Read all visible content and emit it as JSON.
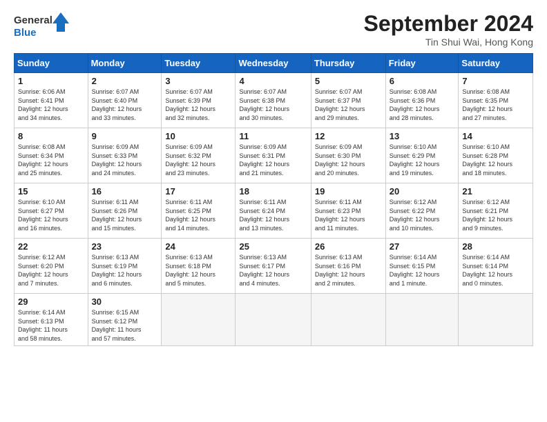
{
  "header": {
    "logo_line1": "General",
    "logo_line2": "Blue",
    "month_title": "September 2024",
    "location": "Tin Shui Wai, Hong Kong"
  },
  "weekdays": [
    "Sunday",
    "Monday",
    "Tuesday",
    "Wednesday",
    "Thursday",
    "Friday",
    "Saturday"
  ],
  "weeks": [
    [
      {
        "day": "1",
        "info": "Sunrise: 6:06 AM\nSunset: 6:41 PM\nDaylight: 12 hours\nand 34 minutes."
      },
      {
        "day": "2",
        "info": "Sunrise: 6:07 AM\nSunset: 6:40 PM\nDaylight: 12 hours\nand 33 minutes."
      },
      {
        "day": "3",
        "info": "Sunrise: 6:07 AM\nSunset: 6:39 PM\nDaylight: 12 hours\nand 32 minutes."
      },
      {
        "day": "4",
        "info": "Sunrise: 6:07 AM\nSunset: 6:38 PM\nDaylight: 12 hours\nand 30 minutes."
      },
      {
        "day": "5",
        "info": "Sunrise: 6:07 AM\nSunset: 6:37 PM\nDaylight: 12 hours\nand 29 minutes."
      },
      {
        "day": "6",
        "info": "Sunrise: 6:08 AM\nSunset: 6:36 PM\nDaylight: 12 hours\nand 28 minutes."
      },
      {
        "day": "7",
        "info": "Sunrise: 6:08 AM\nSunset: 6:35 PM\nDaylight: 12 hours\nand 27 minutes."
      }
    ],
    [
      {
        "day": "8",
        "info": "Sunrise: 6:08 AM\nSunset: 6:34 PM\nDaylight: 12 hours\nand 25 minutes."
      },
      {
        "day": "9",
        "info": "Sunrise: 6:09 AM\nSunset: 6:33 PM\nDaylight: 12 hours\nand 24 minutes."
      },
      {
        "day": "10",
        "info": "Sunrise: 6:09 AM\nSunset: 6:32 PM\nDaylight: 12 hours\nand 23 minutes."
      },
      {
        "day": "11",
        "info": "Sunrise: 6:09 AM\nSunset: 6:31 PM\nDaylight: 12 hours\nand 21 minutes."
      },
      {
        "day": "12",
        "info": "Sunrise: 6:09 AM\nSunset: 6:30 PM\nDaylight: 12 hours\nand 20 minutes."
      },
      {
        "day": "13",
        "info": "Sunrise: 6:10 AM\nSunset: 6:29 PM\nDaylight: 12 hours\nand 19 minutes."
      },
      {
        "day": "14",
        "info": "Sunrise: 6:10 AM\nSunset: 6:28 PM\nDaylight: 12 hours\nand 18 minutes."
      }
    ],
    [
      {
        "day": "15",
        "info": "Sunrise: 6:10 AM\nSunset: 6:27 PM\nDaylight: 12 hours\nand 16 minutes."
      },
      {
        "day": "16",
        "info": "Sunrise: 6:11 AM\nSunset: 6:26 PM\nDaylight: 12 hours\nand 15 minutes."
      },
      {
        "day": "17",
        "info": "Sunrise: 6:11 AM\nSunset: 6:25 PM\nDaylight: 12 hours\nand 14 minutes."
      },
      {
        "day": "18",
        "info": "Sunrise: 6:11 AM\nSunset: 6:24 PM\nDaylight: 12 hours\nand 13 minutes."
      },
      {
        "day": "19",
        "info": "Sunrise: 6:11 AM\nSunset: 6:23 PM\nDaylight: 12 hours\nand 11 minutes."
      },
      {
        "day": "20",
        "info": "Sunrise: 6:12 AM\nSunset: 6:22 PM\nDaylight: 12 hours\nand 10 minutes."
      },
      {
        "day": "21",
        "info": "Sunrise: 6:12 AM\nSunset: 6:21 PM\nDaylight: 12 hours\nand 9 minutes."
      }
    ],
    [
      {
        "day": "22",
        "info": "Sunrise: 6:12 AM\nSunset: 6:20 PM\nDaylight: 12 hours\nand 7 minutes."
      },
      {
        "day": "23",
        "info": "Sunrise: 6:13 AM\nSunset: 6:19 PM\nDaylight: 12 hours\nand 6 minutes."
      },
      {
        "day": "24",
        "info": "Sunrise: 6:13 AM\nSunset: 6:18 PM\nDaylight: 12 hours\nand 5 minutes."
      },
      {
        "day": "25",
        "info": "Sunrise: 6:13 AM\nSunset: 6:17 PM\nDaylight: 12 hours\nand 4 minutes."
      },
      {
        "day": "26",
        "info": "Sunrise: 6:13 AM\nSunset: 6:16 PM\nDaylight: 12 hours\nand 2 minutes."
      },
      {
        "day": "27",
        "info": "Sunrise: 6:14 AM\nSunset: 6:15 PM\nDaylight: 12 hours\nand 1 minute."
      },
      {
        "day": "28",
        "info": "Sunrise: 6:14 AM\nSunset: 6:14 PM\nDaylight: 12 hours\nand 0 minutes."
      }
    ],
    [
      {
        "day": "29",
        "info": "Sunrise: 6:14 AM\nSunset: 6:13 PM\nDaylight: 11 hours\nand 58 minutes."
      },
      {
        "day": "30",
        "info": "Sunrise: 6:15 AM\nSunset: 6:12 PM\nDaylight: 11 hours\nand 57 minutes."
      },
      {
        "day": "",
        "info": ""
      },
      {
        "day": "",
        "info": ""
      },
      {
        "day": "",
        "info": ""
      },
      {
        "day": "",
        "info": ""
      },
      {
        "day": "",
        "info": ""
      }
    ]
  ]
}
